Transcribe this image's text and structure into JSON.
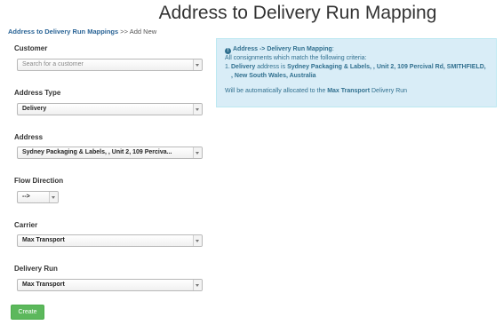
{
  "page": {
    "title": "Address to Delivery Run Mapping"
  },
  "breadcrumb": {
    "link": "Address to Delivery Run Mappings",
    "separator": ">>",
    "current": "Add New"
  },
  "form": {
    "customer": {
      "label": "Customer",
      "placeholder": "Search for a customer"
    },
    "address_type": {
      "label": "Address Type",
      "value": "Delivery"
    },
    "address": {
      "label": "Address",
      "value": "Sydney Packaging & Labels, , Unit 2, 109 Perciva..."
    },
    "flow_direction": {
      "label": "Flow Direction",
      "value": "-->"
    },
    "carrier": {
      "label": "Carrier",
      "value": "Max Transport"
    },
    "delivery_run": {
      "label": "Delivery Run",
      "value": "Max Transport"
    },
    "create_label": "Create"
  },
  "info": {
    "heading": "Address -> Delivery Run Mapping",
    "heading_suffix": ":",
    "intro": "All consignments which match the following criteria:",
    "criteria_number": "1.",
    "criteria_type": "Delivery",
    "criteria_text": "address is",
    "criteria_address": "Sydney Packaging & Labels, , Unit 2, 109 Percival Rd, SMITHFIELD, , New South Wales, Australia",
    "result_prefix": "Will be automatically allocated to the",
    "result_run": "Max Transport",
    "result_suffix": "Delivery Run"
  },
  "colors": {
    "info_bg": "#d9edf7",
    "info_text": "#31708f",
    "create_button": "#5cb85c",
    "link": "#2a6496"
  }
}
